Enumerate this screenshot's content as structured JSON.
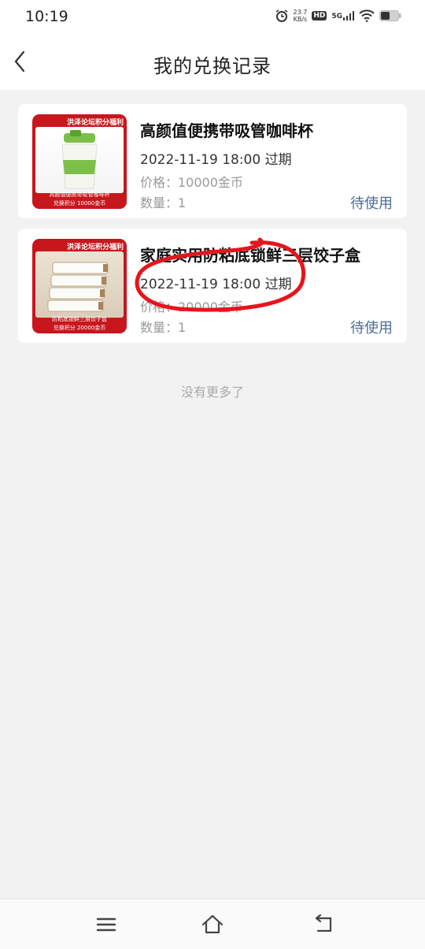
{
  "status_bar": {
    "time": "10:19",
    "net_speed_value": "23.7",
    "net_speed_unit": "KB/s",
    "hd_label": "HD",
    "network_label": "5G"
  },
  "header": {
    "title": "我的兑换记录"
  },
  "records": [
    {
      "thumb_banner": "洪泽论坛积分福利",
      "thumb_caption": "高颜值便携带吸管咖啡杯",
      "thumb_price": "兑换积分  10000金币",
      "name": "高颜值便携带吸管咖啡杯",
      "expire": "2022-11-19 18:00 过期",
      "price": "价格：10000金币",
      "quantity": "数量：1",
      "status": "待使用"
    },
    {
      "thumb_banner": "洪泽论坛积分福利",
      "thumb_caption": "防粘底锁鲜三层饺子盒",
      "thumb_price": "兑换积分  20000金币",
      "name": "家庭实用防粘底锁鲜三层饺子盒",
      "expire": "2022-11-19 18:00 过期",
      "price": "价格：20000金币",
      "quantity": "数量：1",
      "status": "待使用"
    }
  ],
  "footer": {
    "no_more": "没有更多了"
  },
  "colors": {
    "accent_red": "#c8161d",
    "status_blue": "#4a6d9a",
    "annotation_red": "#e8141c"
  }
}
